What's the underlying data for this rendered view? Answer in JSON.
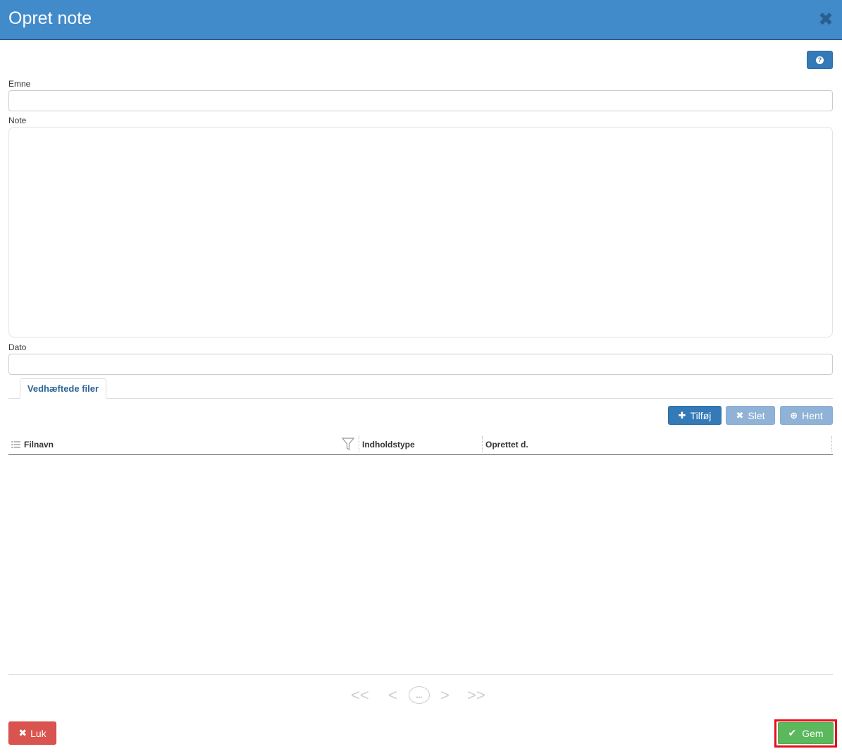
{
  "dialog": {
    "title": "Opret note",
    "close_icon": "close-icon",
    "help_icon": "question-icon"
  },
  "form": {
    "subject_label": "Emne",
    "subject_value": "",
    "note_label": "Note",
    "note_value": "",
    "date_label": "Dato",
    "date_value": ""
  },
  "tabs": [
    {
      "label": "Vedhæftede filer",
      "active": true
    }
  ],
  "toolbar": {
    "add_label": "Tilføj",
    "delete_label": "Slet",
    "get_label": "Hent"
  },
  "grid": {
    "columns": [
      "Filnavn",
      "Indholdstype",
      "Oprettet d."
    ],
    "rows": []
  },
  "pager": {
    "first": "<<",
    "prev": "<",
    "current": "...",
    "next": ">",
    "last": ">>"
  },
  "footer": {
    "close_label": "Luk",
    "save_label": "Gem"
  },
  "colors": {
    "header": "#428bca",
    "primary": "#337ab7",
    "danger": "#d9534f",
    "success": "#5cb85c",
    "highlight": "#e3101c"
  }
}
